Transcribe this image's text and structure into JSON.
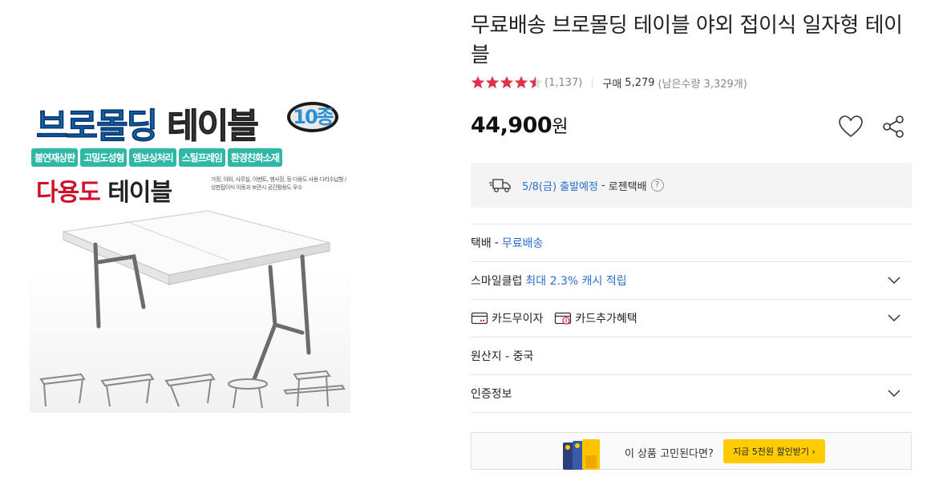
{
  "product_image": {
    "title_blue": "브로몰딩",
    "title_dark": "테이블",
    "badge": "10종",
    "tags": [
      "불연재상판",
      "고밀도성형",
      "엠보싱처리",
      "스틸프레임",
      "환경친화소재"
    ],
    "sub_red": "다용도",
    "sub_dark": "테이블",
    "desc": "가정, 야외, 사무실, 이벤트, 행사장, 등 다용도 사용 다리수납형 / 상판접이식 이동과 보관시 공간활용도 우수"
  },
  "product": {
    "title": "무료배송 브로몰딩 테이블 야외 접이식 일자형 테이블",
    "rating": 4.5,
    "review_count": "(1,137)",
    "purchase_label": "구매",
    "purchase_count": "5,279",
    "remaining": "(남은수량 3,329개)",
    "price": "44,900",
    "currency": "원"
  },
  "icons": {
    "wish": "heart-icon",
    "share": "share-icon",
    "truck": "truck-icon",
    "chevron": "chevron-down-icon"
  },
  "delivery": {
    "date": "5/8(금) 출발예정",
    "separator": "-",
    "carrier": "로젠택배",
    "help": "?"
  },
  "info": {
    "shipping_label": "택배",
    "shipping_sep": "-",
    "shipping_value": "무료배송",
    "smileclub_label": "스마일클럽",
    "smileclub_value": "최대 2.3% 캐시 적립",
    "card_interest_free": "카드무이자",
    "card_benefit": "카드추가혜택",
    "origin": "원산지 - 중국",
    "certification": "인증정보"
  },
  "promo": {
    "text": "이 상품 고민된다면?",
    "button": "지금 5천원 할인받기 ›"
  },
  "colors": {
    "star": "#e0304a",
    "link_blue": "#2a6fcf",
    "promo_yellow": "#ffcc00",
    "delivery_bg": "#f4f4f4"
  }
}
